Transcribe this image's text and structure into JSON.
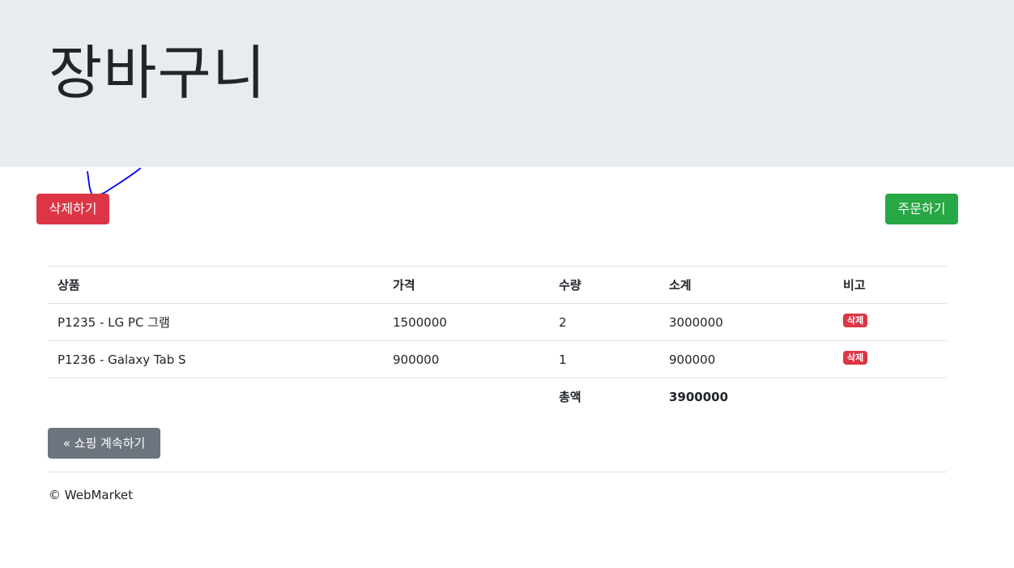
{
  "header": {
    "title": "장바구니"
  },
  "actions": {
    "delete_all_label": "삭제하기",
    "order_label": "주문하기"
  },
  "table": {
    "headers": [
      "상품",
      "가격",
      "수량",
      "소계",
      "비고"
    ],
    "rows": [
      {
        "product": "P1235 - LG PC 그램",
        "price": "1500000",
        "quantity": "2",
        "subtotal": "3000000",
        "action": "삭제"
      },
      {
        "product": "P1236 - Galaxy Tab S",
        "price": "900000",
        "quantity": "1",
        "subtotal": "900000",
        "action": "삭제"
      }
    ],
    "total_label": "총액",
    "total_value": "3900000"
  },
  "continue_label": "« 쇼핑 계속하기",
  "footer": {
    "text": "© WebMarket"
  },
  "colors": {
    "jumbotron": "#e9ecef",
    "danger": "#dc3545",
    "success": "#28a745",
    "secondary": "#6c757d",
    "annotation": "#0000ff"
  }
}
